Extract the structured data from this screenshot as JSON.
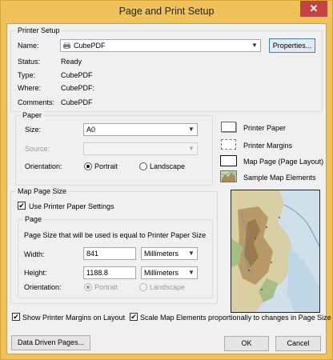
{
  "window": {
    "title": "Page and Print Setup",
    "close_glyph": "✕"
  },
  "printer_setup": {
    "group_label": "Printer Setup",
    "name_label": "Name:",
    "name_value": "CubePDF",
    "properties_button": "Properties...",
    "status_label": "Status:",
    "status_value": "Ready",
    "type_label": "Type:",
    "type_value": "CubePDF",
    "where_label": "Where:",
    "where_value": "CubePDF:",
    "comments_label": "Comments:",
    "comments_value": "CubePDF"
  },
  "paper": {
    "group_label": "Paper",
    "size_label": "Size:",
    "size_value": "A0",
    "source_label": "Source:",
    "source_value": "",
    "orientation_label": "Orientation:",
    "portrait_label": "Portrait",
    "landscape_label": "Landscape",
    "orientation_selected": "Portrait"
  },
  "legend": {
    "printer_paper": "Printer Paper",
    "printer_margins": "Printer Margins",
    "map_page": "Map Page (Page Layout)",
    "sample_map_elements": "Sample Map Elements"
  },
  "map_page_size": {
    "group_label": "Map Page Size",
    "use_printer_settings_label": "Use Printer Paper Settings",
    "use_printer_settings_checked": true,
    "page_group_label": "Page",
    "info_text": "Page Size that will be used is equal to Printer Paper Size",
    "width_label": "Width:",
    "width_value": "841",
    "width_unit": "Millimeters",
    "height_label": "Height:",
    "height_value": "1188.8",
    "height_unit": "Millimeters",
    "orientation_label": "Orientation:",
    "portrait_label": "Portrait",
    "landscape_label": "Landscape"
  },
  "options": {
    "show_margins_label": "Show Printer Margins on Layout",
    "show_margins_checked": true,
    "scale_elements_label": "Scale Map Elements proportionally to changes in Page Size",
    "scale_elements_checked": true
  },
  "buttons": {
    "data_driven_pages": "Data Driven Pages...",
    "ok": "OK",
    "cancel": "Cancel"
  },
  "colors": {
    "title_bar": "#f0c25c",
    "close_button": "#c74242",
    "dialog_bg": "#f0f0f0"
  }
}
